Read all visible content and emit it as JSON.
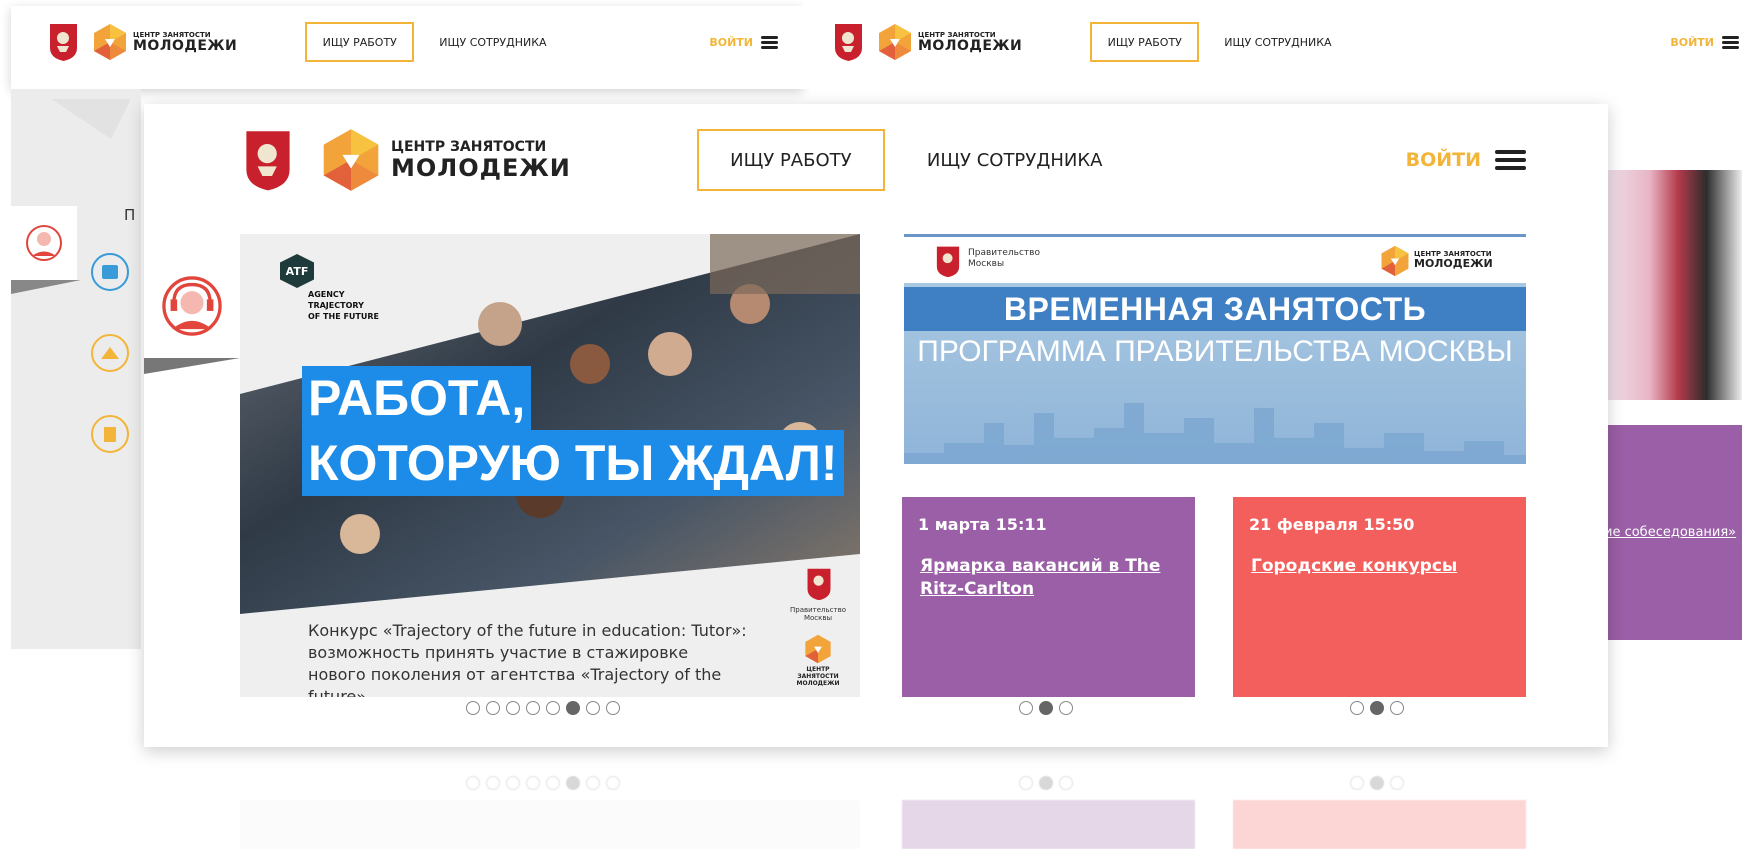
{
  "brand": {
    "line1": "ЦЕНТР ЗАНЯТОСТИ",
    "line2": "МОЛОДЕЖИ"
  },
  "nav": {
    "find_job": "ИЩУ РАБОТУ",
    "find_employee": "ИЩУ СОТРУДНИКА",
    "login": "ВОЙТИ"
  },
  "hero": {
    "atf_badge": "ATF",
    "atf_text": "AGENCY\nTRAJECTORY\nOF THE FUTURE",
    "headline_1": "РАБОТА,",
    "headline_2": "КОТОРУЮ ТЫ ЖДАЛ!",
    "caption": "Конкурс «Trajectory of the future in education: Tutor»: возможность принять участие в стажировке нового поколения от агентства «Trajectory of the future».",
    "gov_label": "Правительство Москвы",
    "mini_brand": "ЦЕНТР ЗАНЯТОСТИ МОЛОДЕЖИ",
    "slides_total": 8,
    "slide_active": 6
  },
  "banner": {
    "gov_label": "Правительство Москвы",
    "brand_small_1": "ЦЕНТР ЗАНЯТОСТИ",
    "brand_small_2": "МОЛОДЕЖИ",
    "title": "ВРЕМЕННАЯ ЗАНЯТОСТЬ",
    "subtitle": "ПРОГРАММА ПРАВИТЕЛЬСТВА МОСКВЫ"
  },
  "news": [
    {
      "date": "1 марта 15:11",
      "title": "Ярмарка вакансий в The Ritz-Carlton",
      "color": "#9a5fa6"
    },
    {
      "date": "21 февраля 15:50",
      "title": "Городские конкурсы",
      "color": "#f25f5c"
    }
  ],
  "news_dots_1": {
    "total": 3,
    "active": 2
  },
  "news_dots_2": {
    "total": 3,
    "active": 2
  },
  "right_card": {
    "link_fragment": "ие собеседования»"
  },
  "left_card": {
    "letter": "П"
  },
  "colors": {
    "accent": "#f2b53a",
    "purple": "#9a5fa6",
    "coral": "#f25f5c",
    "banner_blue": "#3f7fc4",
    "headline_bg": "#1c8ce8"
  }
}
